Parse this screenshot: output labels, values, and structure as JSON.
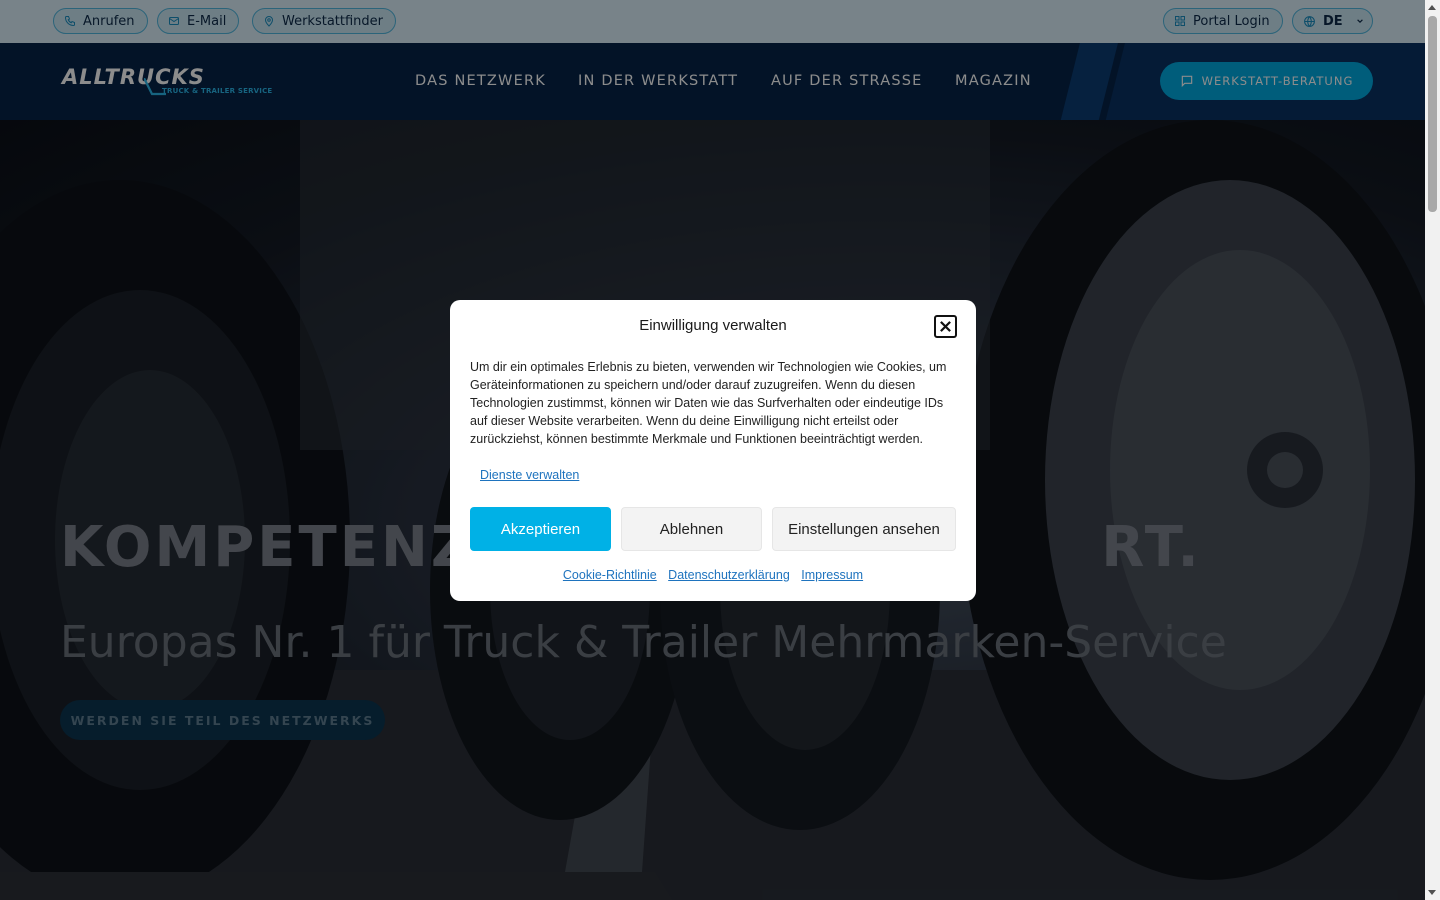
{
  "topbar": {
    "call_label": "Anrufen",
    "email_label": "E-Mail",
    "finder_label": "Werkstattfinder",
    "portal_label": "Portal Login",
    "language": "DE"
  },
  "nav": {
    "logo_text": "ALLTRUCKS",
    "logo_sub": "TRUCK & TRAILER SERVICE",
    "items": [
      "DAS NETZWERK",
      "IN DER WERKSTATT",
      "AUF DER STRASSE",
      "MAGAZIN"
    ],
    "cta_label": "WERKSTATT-BERATUNG"
  },
  "hero": {
    "title": "KOMPETENZ, ",
    "title_end": "RT.",
    "subtitle": "Europas Nr. 1 für Truck & Trailer Mehrmarken-Service",
    "cta_label": "WERDEN SIE TEIL DES NETZWERKS"
  },
  "consent": {
    "title": "Einwilligung verwalten",
    "text": "Um dir ein optimales Erlebnis zu bieten, verwenden wir Technologien wie Cookies, um Geräteinformationen zu speichern und/oder darauf zuzugreifen. Wenn du diesen Technologien zustimmst, können wir Daten wie das Surfverhalten oder eindeutige IDs auf dieser Website verarbeiten. Wenn du deine Einwilligung nicht erteilst oder zurückziehst, können bestimmte Merkmale und Funktionen beeinträchtigt werden.",
    "manage_label": "Dienste verwalten",
    "accept_label": "Akzeptieren",
    "deny_label": "Ablehnen",
    "prefs_label": "Einstellungen ansehen",
    "links": {
      "cookie": "Cookie-Richtlinie",
      "privacy": "Datenschutzerklärung",
      "imprint": "Impressum"
    }
  },
  "colors": {
    "brand_navy": "#062448",
    "accent_cyan": "#00a9e0",
    "topbar_bg": "#dbeef9"
  }
}
